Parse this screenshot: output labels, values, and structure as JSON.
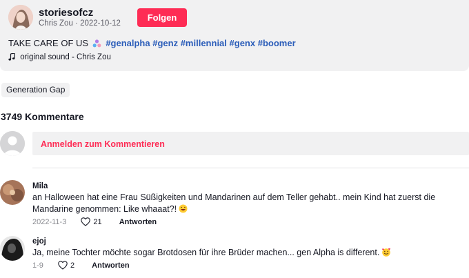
{
  "post": {
    "username": "storiesofcz",
    "meta": "Chris Zou · 2022-10-12",
    "follow_label": "Folgen",
    "caption_text": "TAKE CARE OF US",
    "hashtags": [
      "#genalpha",
      "#genz",
      "#millennial",
      "#genx",
      "#boomer"
    ],
    "sound": "original sound - Chris Zou"
  },
  "chip": {
    "label": "Generation Gap"
  },
  "comments_header": {
    "count_label": "3749 Kommentare"
  },
  "login": {
    "prompt": "Anmelden zum Kommentieren"
  },
  "comments": [
    {
      "user": "Mila",
      "text": "an Halloween hat eine Frau Süßigkeiten und Mandarinen auf dem Teller gehabt.. mein Kind hat zuerst die Mandarine genommen: Like whaaat?!",
      "date": "2022-11-3",
      "likes": "21",
      "reply_label": "Antworten"
    },
    {
      "user": "ejoj",
      "text": "Ja, meine Tochter möchte sogar Brotdosen für ihre Brüder machen... gen Alpha is different.",
      "date": "1-9",
      "likes": "2",
      "reply_label": "Antworten"
    }
  ],
  "colors": {
    "accent": "#fe2c55",
    "hashtag": "#2b5db9",
    "card_bg": "#f1f1f2",
    "muted": "#8a8b91"
  }
}
